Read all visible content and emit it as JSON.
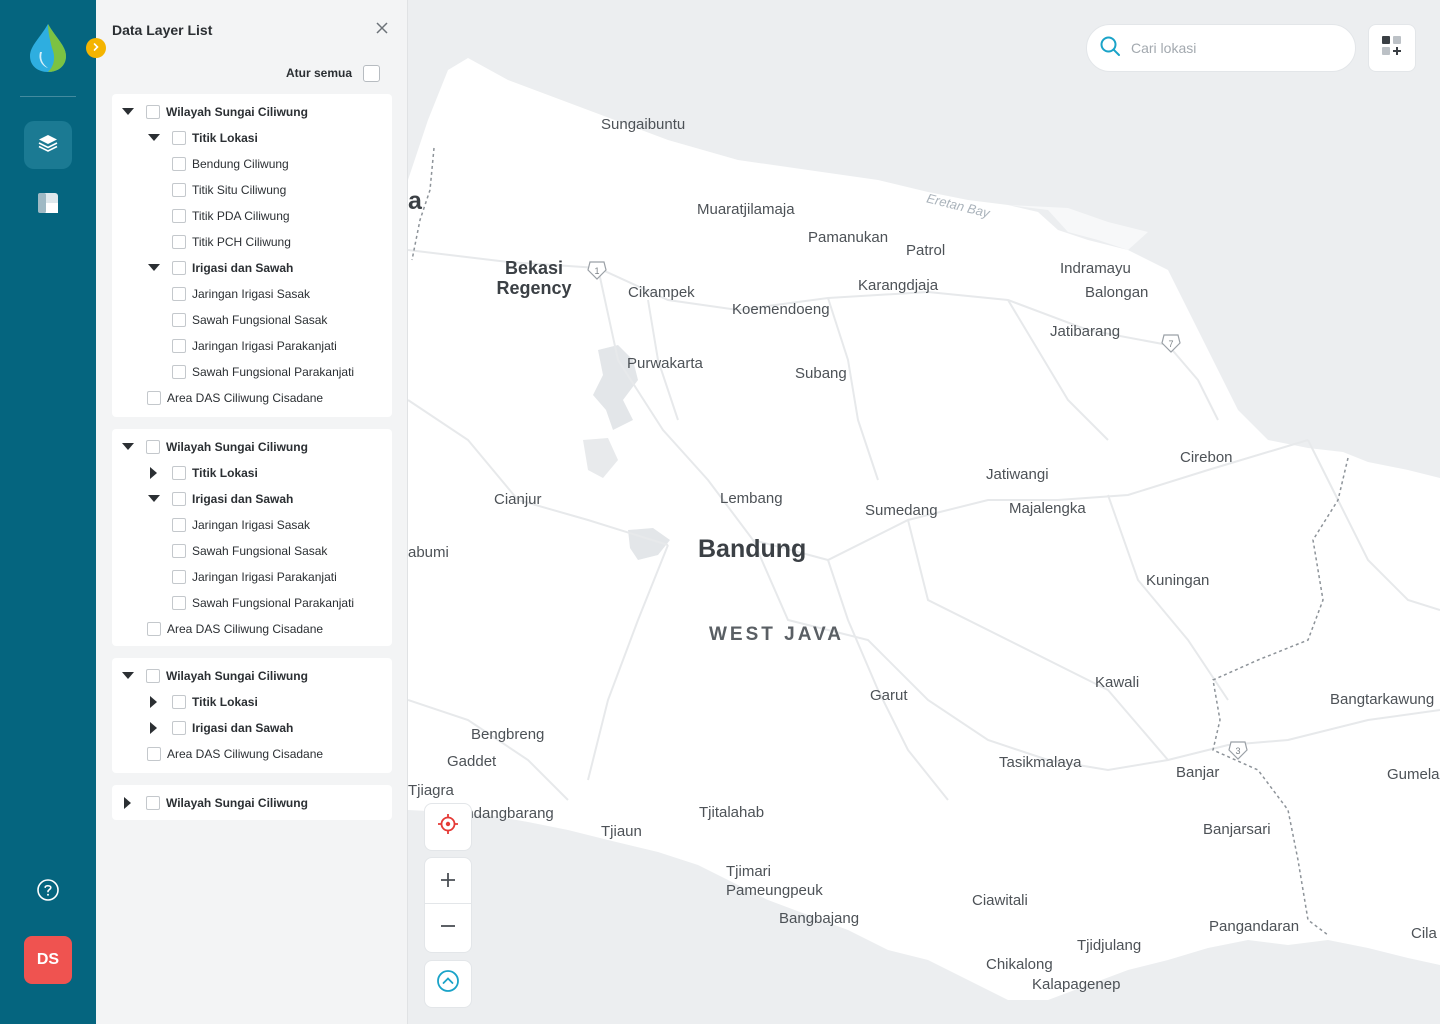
{
  "panel": {
    "title": "Data Layer List",
    "set_all_label": "Atur semua"
  },
  "groups": [
    {
      "title": "Wilayah Sungai Ciliwung",
      "sub1_title": "Titik Lokasi",
      "sub1_items": [
        "Bendung Ciliwung",
        "Titik Situ Ciliwung",
        "Titik PDA Ciliwung",
        "Titik PCH Ciliwung"
      ],
      "sub2_title": "Irigasi dan Sawah",
      "sub2_items": [
        "Jaringan Irigasi Sasak",
        "Sawah Fungsional Sasak",
        "Jaringan Irigasi Parakanjati",
        "Sawah Fungsional Parakanjati"
      ],
      "area": "Area DAS Ciliwung Cisadane"
    },
    {
      "title": "Wilayah Sungai Ciliwung",
      "sub1_title": "Titik Lokasi",
      "sub2_title": "Irigasi dan Sawah",
      "sub2_items": [
        "Jaringan Irigasi Sasak",
        "Sawah Fungsional Sasak",
        "Jaringan Irigasi Parakanjati",
        "Sawah Fungsional Parakanjati"
      ],
      "area": "Area DAS Ciliwung Cisadane"
    },
    {
      "title": "Wilayah Sungai Ciliwung",
      "sub1_title": "Titik Lokasi",
      "sub2_title": "Irigasi dan Sawah",
      "area": "Area DAS Ciliwung Cisadane"
    },
    {
      "title": "Wilayah Sungai Ciliwung"
    }
  ],
  "rail": {
    "avatar_initials": "DS"
  },
  "search": {
    "placeholder": "Cari lokasi"
  },
  "map": {
    "labels": {
      "sungaibuntu": "Sungaibuntu",
      "muaratjilamaja": "Muaratjilamaja",
      "eretan_bay": "Eretan Bay",
      "pamanukan": "Pamanukan",
      "patrol": "Patrol",
      "bekasi_regency": "Bekasi Regency",
      "cikampek": "Cikampek",
      "karangdjaja": "Karangdjaja",
      "indramayu": "Indramayu",
      "balongan": "Balongan",
      "koemendoeng": "Koemendoeng",
      "jatibarang": "Jatibarang",
      "purwakarta": "Purwakarta",
      "subang": "Subang",
      "cirebon": "Cirebon",
      "jatiwangi": "Jatiwangi",
      "cianjur": "Cianjur",
      "lembang": "Lembang",
      "sumedang": "Sumedang",
      "majalengka": "Majalengka",
      "bandung": "Bandung",
      "sukabumi_partial": "abumi",
      "jakarta_partial": "a",
      "kuningan": "Kuningan",
      "west_java": "WEST JAVA",
      "kawali": "Kawali",
      "garut": "Garut",
      "bangtarkawung": "Bangtarkawung",
      "bengbreng": "Bengbreng",
      "gaddet": "Gaddet",
      "tasikmalaya": "Tasikmalaya",
      "banjar": "Banjar",
      "gumela_partial": "Gumela",
      "tjiagra": "Tjiagra",
      "sindangbarang_partial": "indangbarang",
      "tjitalahab": "Tjitalahab",
      "tjiaun": "Tjiaun",
      "banjarsari": "Banjarsari",
      "tjimari": "Tjimari",
      "pameungpeuk": "Pameungpeuk",
      "ciawitali": "Ciawitali",
      "bangbajang": "Bangbajang",
      "pangandaran": "Pangandaran",
      "cila_partial": "Cila",
      "tjidjulang": "Tjidjulang",
      "chikalong": "Chikalong",
      "kalapagenep": "Kalapagenep"
    },
    "road_shields": [
      "1",
      "7",
      "3"
    ]
  },
  "colors": {
    "rail": "#05657f",
    "accent": "#f4b400",
    "avatar": "#ef5350",
    "locate": "#e53935",
    "search_icon": "#1aa3c8"
  }
}
